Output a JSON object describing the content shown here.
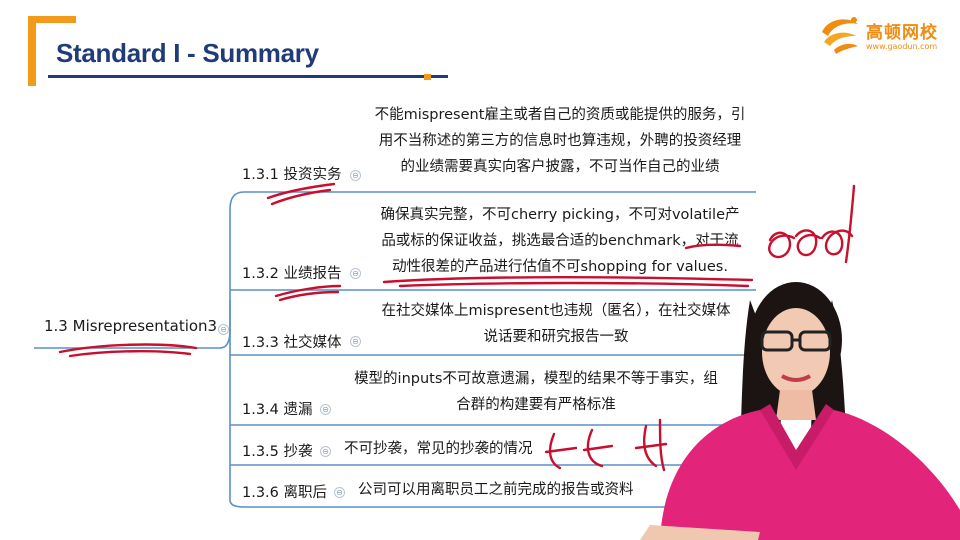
{
  "slide": {
    "title": "Standard I - Summary",
    "accent_color": "#f29a1a",
    "title_color": "#1f3c78"
  },
  "logo": {
    "name": "高顿网校",
    "url": "www.gaodun.com",
    "color": "#f08c12"
  },
  "mindmap": {
    "root": "1.3 Misrepresentation3",
    "branches": [
      {
        "label": "1.3.1 投资实务",
        "lines": [
          "不能mispresent雇主或者自己的资质或能提供的服务，引",
          "用不当称述的第三方的信息时也算违规，外聘的投资经理",
          "的业绩需要真实向客户披露，不可当作自己的业绩"
        ]
      },
      {
        "label": "1.3.2 业绩报告",
        "lines": [
          "确保真实完整，不可cherry picking，不可对volatile产",
          "品或标的保证收益，挑选最合适的benchmark，对于流",
          "动性很差的产品进行估值不可shopping for values."
        ]
      },
      {
        "label": "1.3.3 社交媒体",
        "lines": [
          "在社交媒体上mispresent也违规（匿名），在社交媒体",
          "说话要和研究报告一致"
        ]
      },
      {
        "label": "1.3.4 遗漏",
        "lines": [
          "模型的inputs不可故意遗漏，模型的结果不等于事实，组",
          "合群的构建要有严格标准"
        ]
      },
      {
        "label": "1.3.5 抄袭",
        "lines": [
          "不可抄袭，常见的抄袭的情况"
        ]
      },
      {
        "label": "1.3.6 离职后",
        "lines": [
          "公司可以用离职员工之前完成的报告或资料"
        ]
      }
    ],
    "line_color": "#5b8fc7",
    "collapse_icon": "⊖"
  },
  "annotations": {
    "ink_color": "#c8102e"
  }
}
